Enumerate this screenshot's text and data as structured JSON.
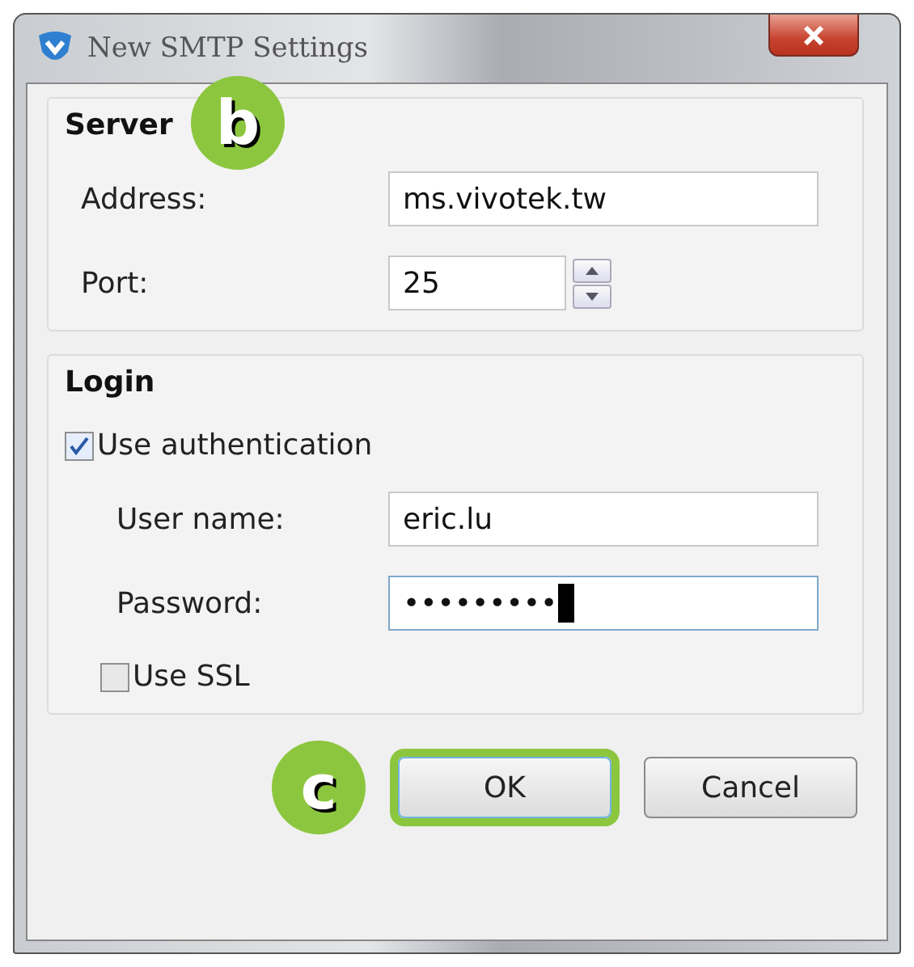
{
  "window": {
    "title": "New SMTP Settings"
  },
  "server": {
    "heading": "Server",
    "callout": "b",
    "fields": [
      {
        "label": "Address:",
        "value": "ms.vivotek.tw",
        "kind": "text"
      },
      {
        "label": "Port:",
        "value": "25",
        "kind": "spin"
      }
    ]
  },
  "login": {
    "heading": "Login",
    "use_authentication": {
      "label": "Use authentication",
      "checked": true
    },
    "fields": [
      {
        "label": "User name:",
        "value": "eric.lu",
        "focused": false
      },
      {
        "label": "Password:",
        "value": "•••••••••",
        "focused": true
      }
    ],
    "use_ssl": {
      "label": "Use SSL",
      "checked": false
    }
  },
  "buttons": [
    {
      "label": "OK",
      "highlighted": true,
      "callout": "c"
    },
    {
      "label": "Cancel",
      "highlighted": false
    }
  ]
}
